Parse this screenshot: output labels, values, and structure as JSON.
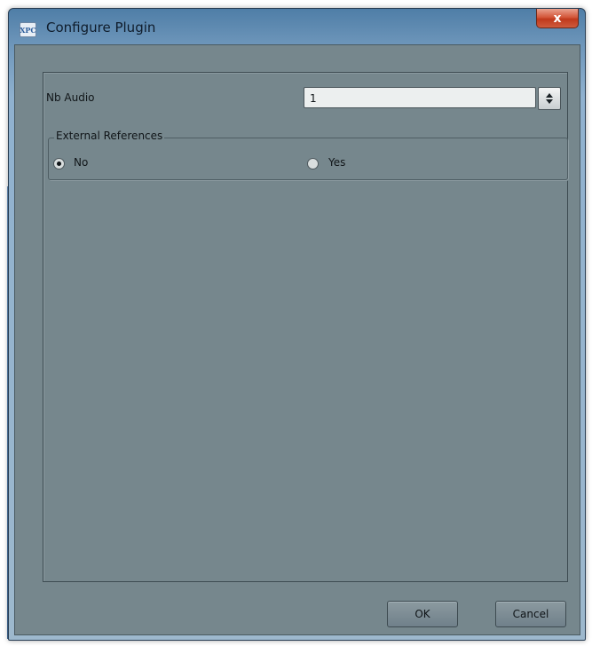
{
  "window": {
    "title": "Configure Plugin",
    "app_icon": "xpc-app-icon",
    "app_icon_text": "XPC",
    "close_symbol": "x"
  },
  "fields": {
    "nb_audio_label": "Nb Audio",
    "nb_audio_value": "1"
  },
  "external_references": {
    "title": "External References",
    "options": [
      {
        "label": "No",
        "selected": true
      },
      {
        "label": "Yes",
        "selected": false
      }
    ]
  },
  "buttons": {
    "ok": "OK",
    "cancel": "Cancel"
  },
  "colors": {
    "client_bg": "#76878d",
    "titlebar": "#6f97bb",
    "close_button": "#c0391c"
  }
}
